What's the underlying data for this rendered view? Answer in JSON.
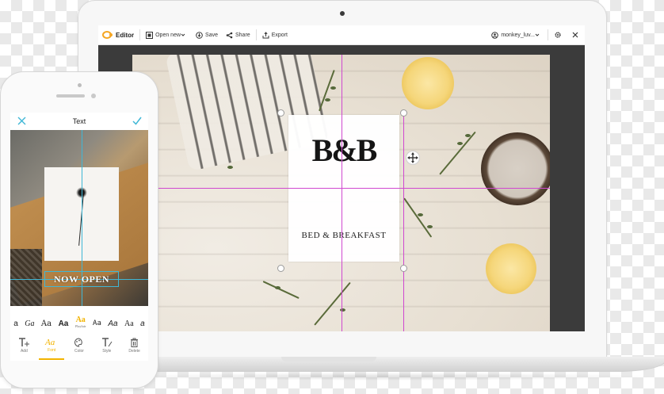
{
  "toolbar": {
    "app_label": "Editor",
    "open_new": "Open new",
    "save": "Save",
    "share": "Share",
    "export": "Export",
    "user": "monkey_luv..."
  },
  "canvas": {
    "card_monogram": "B&B",
    "card_title": "BED & BREAKFAST"
  },
  "phone": {
    "header_title": "Text",
    "overlay_text": "NOW OPEN",
    "font_samples": [
      {
        "label": "a",
        "sub": ""
      },
      {
        "label": "Ga",
        "sub": ""
      },
      {
        "label": "Aa",
        "sub": ""
      },
      {
        "label": "Aa",
        "sub": ""
      },
      {
        "label": "Aa",
        "sub": "Playfair"
      },
      {
        "label": "Aa",
        "sub": ""
      },
      {
        "label": "Aa",
        "sub": ""
      },
      {
        "label": "Aa",
        "sub": ""
      },
      {
        "label": "a",
        "sub": ""
      }
    ],
    "tools": [
      {
        "label": "Add",
        "icon": "text-add-icon"
      },
      {
        "label": "Font",
        "icon": "font-icon"
      },
      {
        "label": "Color",
        "icon": "palette-icon"
      },
      {
        "label": "Style",
        "icon": "style-icon"
      },
      {
        "label": "Delete",
        "icon": "trash-icon"
      }
    ]
  },
  "colors": {
    "accent": "#f2b300",
    "guide": "#d048d0",
    "phone_guide": "#3fb7d6",
    "logo": "#f5a623"
  }
}
